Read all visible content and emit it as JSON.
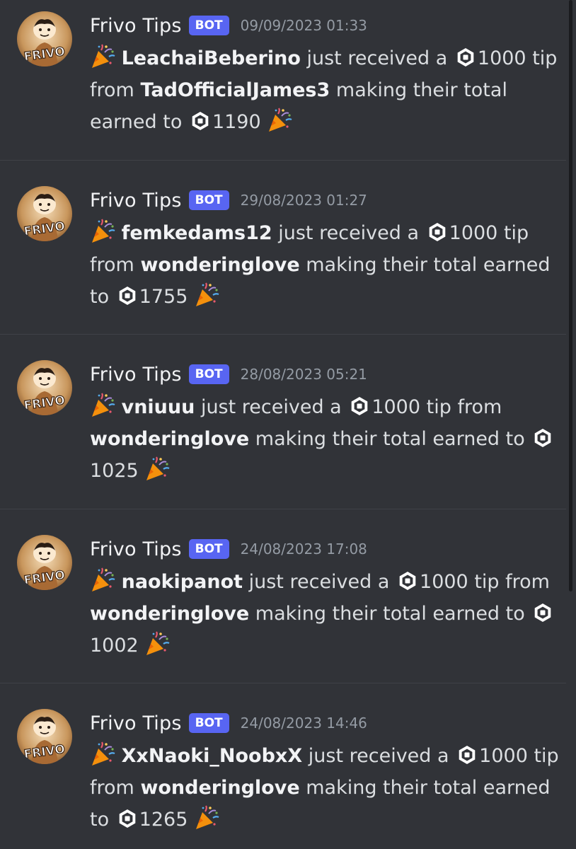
{
  "author_name": "Frivo Tips",
  "bot_tag": "BOT",
  "text_received": "just received a",
  "text_tip_from": "tip from",
  "text_making_total": "making their total earned to",
  "colors": {
    "background": "#313338",
    "bot_tag": "#5865f2",
    "timestamp": "#949ba4",
    "text": "#dbdee1"
  },
  "icons": [
    "party-popper-icon",
    "robux-icon",
    "frivo-avatar-icon"
  ],
  "messages": [
    {
      "timestamp": "09/09/2023 01:33",
      "recipient": "LeachaiBeberino",
      "amount": "1000",
      "sender": "TadOfficialJames3",
      "total": "1190"
    },
    {
      "timestamp": "29/08/2023 01:27",
      "recipient": "femkedams12",
      "amount": "1000",
      "sender": "wonderinglove",
      "total": "1755"
    },
    {
      "timestamp": "28/08/2023 05:21",
      "recipient": "vniuuu",
      "amount": "1000",
      "sender": "wonderinglove",
      "total": "1025"
    },
    {
      "timestamp": "24/08/2023 17:08",
      "recipient": "naokipanot",
      "amount": "1000",
      "sender": "wonderinglove",
      "total": "1002"
    },
    {
      "timestamp": "24/08/2023 14:46",
      "recipient": "XxNaoki_NoobxX",
      "amount": "1000",
      "sender": "wonderinglove",
      "total": "1265"
    }
  ]
}
